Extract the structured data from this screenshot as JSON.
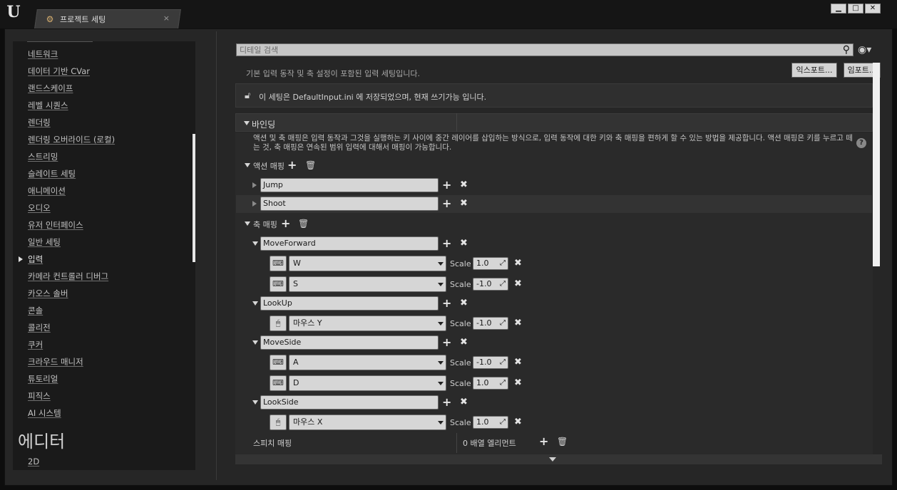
{
  "window": {
    "tab_title": "프로젝트 세팅",
    "tab_close": "×",
    "controls": {
      "minimize": "▁",
      "maximize": "□",
      "close": "✕"
    }
  },
  "nav": {
    "items": [
      {
        "label": "네트워크"
      },
      {
        "label": "데이터 기반 CVar"
      },
      {
        "label": "랜드스케이프"
      },
      {
        "label": "레벨 시퀀스"
      },
      {
        "label": "렌더링"
      },
      {
        "label": "렌더링 오버라이드 (로컬)"
      },
      {
        "label": "스트리밍"
      },
      {
        "label": "슬레이트 세팅"
      },
      {
        "label": "애니메이션"
      },
      {
        "label": "오디오"
      },
      {
        "label": "유저 인터페이스"
      },
      {
        "label": "일반 세팅"
      },
      {
        "label": "입력",
        "active": true
      },
      {
        "label": "카메라 컨트롤러 디버그"
      },
      {
        "label": "카오스 솔버"
      },
      {
        "label": "콘솔"
      },
      {
        "label": "콜리전"
      },
      {
        "label": "쿠커"
      },
      {
        "label": "크라우드 매니저"
      },
      {
        "label": "튜토리얼"
      },
      {
        "label": "피직스"
      },
      {
        "label": "AI 시스템"
      }
    ],
    "section_heading": "에디터",
    "after_heading": [
      {
        "label": "2D"
      }
    ]
  },
  "details": {
    "search_placeholder": "디테일 검색",
    "page_description": "기본 입력 동작 및 축 설정이 포함된 입력 세팅입니다.",
    "export_button": "익스포트...",
    "import_button": "임포트...",
    "info_text": "이 세팅은 DefaultInput.ini 에 저장되었으며, 현재 쓰기가능 입니다.",
    "category": {
      "title": "바인딩",
      "description": "액션 및 축 매핑은 입력 동작과 그것을 실행하는 키 사이에 중간 레이어를 삽입하는 방식으로, 입력 동작에 대한 키와 축 매핑을 편하게 할 수 있는 방법을 제공합니다. 액션 매핑은 키를 누르고 떼는 것, 축 매핑은 연속된 범위 입력에 대해서 매핑이 가능합니다.",
      "action_mappings_label": "액션 매핑",
      "action_mappings": [
        {
          "name": "Jump"
        },
        {
          "name": "Shoot"
        }
      ],
      "axis_mappings_label": "축 매핑",
      "scale_label": "Scale",
      "axis_mappings": [
        {
          "name": "MoveForward",
          "keys": [
            {
              "key": "W",
              "scale": "1.0",
              "device": "keyboard"
            },
            {
              "key": "S",
              "scale": "-1.0",
              "device": "keyboard"
            }
          ]
        },
        {
          "name": "LookUp",
          "keys": [
            {
              "key": "마우스 Y",
              "scale": "-1.0",
              "device": "mouse"
            }
          ]
        },
        {
          "name": "MoveSide",
          "keys": [
            {
              "key": "A",
              "scale": "-1.0",
              "device": "keyboard"
            },
            {
              "key": "D",
              "scale": "1.0",
              "device": "keyboard"
            }
          ]
        },
        {
          "name": "LookSide",
          "keys": [
            {
              "key": "마우스 X",
              "scale": "1.0",
              "device": "mouse"
            }
          ]
        }
      ],
      "speech_mappings_label": "스피치 매핑",
      "speech_mappings_value": "0 배열 엘리먼트"
    }
  },
  "colors": {
    "background": "#262626",
    "field": "#d6d6d6",
    "accent_text": "#dcdcdc"
  }
}
